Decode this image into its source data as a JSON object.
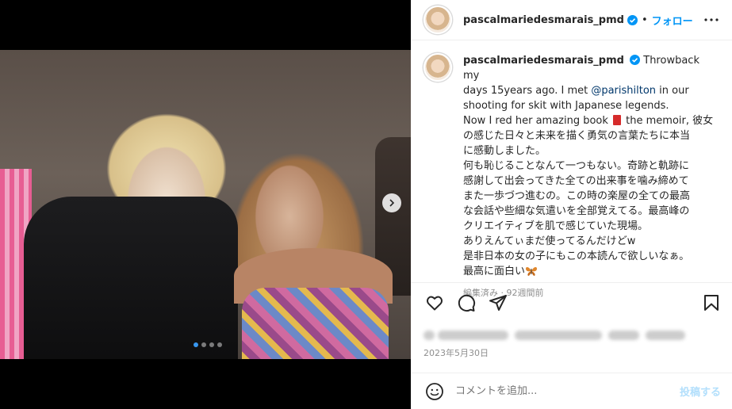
{
  "post": {
    "username": "pascalmariedesmarais_pmd",
    "follow_label": "フォロー",
    "separator": "•",
    "caption_lines": {
      "l1": "Throwback my",
      "l2": "days 15years ago. I met ",
      "mention": "@parishilton",
      "l2b": " in our",
      "l3": "shooting for skit with Japanese legends.",
      "l4a": "Now I red her amazing book ",
      "l4b": " the memoir, 彼女",
      "l5": "の感じた日々と未来を描く勇気の言葉たちに本当",
      "l6": "に感動しました。",
      "l7": "何も恥じることなんて一つもない。奇跡と軌跡に",
      "l8": "感謝して出会ってきた全ての出来事を噛み締めて",
      "l9": "また一歩づつ進むの。この時の楽屋の全ての最高",
      "l10": "な会話や些細な気遣いを全部覚えてる。最高峰の",
      "l11": "クリエイティブを肌で感じていた現場。",
      "l12": "ありえんてぃまだ使ってるんだけどw",
      "l13": "是非日本の女の子にもこの本読んで欲しいなぁ。",
      "l14": "最高に面白い"
    },
    "meta": "編集済み · 92週間前",
    "date": "2023年5月30日",
    "comment_placeholder": "コメントを追加...",
    "post_label": "投稿する"
  },
  "carousel": {
    "count": 4,
    "active": 0
  },
  "colors": {
    "accent": "#0095f6",
    "verified": "#0095f6",
    "mention": "#00376b",
    "muted": "#8e8e8e"
  },
  "icons": [
    "heart-icon",
    "comment-icon",
    "share-icon",
    "bookmark-icon",
    "more-icon",
    "emoji-icon",
    "chevron-right-icon",
    "verified-icon",
    "book-icon",
    "butterfly-icon"
  ]
}
